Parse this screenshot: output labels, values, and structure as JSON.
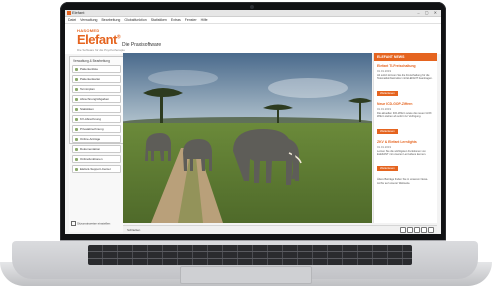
{
  "titlebar": {
    "title": "Elefant",
    "icon": "app-icon"
  },
  "menubar": {
    "items": [
      "Datei",
      "Verwaltung",
      "Bearbeitung",
      "Globalfunktion",
      "Statistiken",
      "Extras",
      "Fenster",
      "Hilfe"
    ]
  },
  "header": {
    "logo_top": "HASOMED",
    "logo_main": "Elefant",
    "logo_mark": "®",
    "logo_sub": "Die Software für die Psychotherapie",
    "page_title": "Die Praxisoftware"
  },
  "sidebar": {
    "heading": "Verwaltung & Bearbeitung",
    "items": [
      {
        "label": "Patientenliste"
      },
      {
        "label": "Patientenkartei"
      },
      {
        "label": "Terminplan"
      },
      {
        "label": "Abrechnung/Abgaben"
      },
      {
        "label": "Statistiken"
      },
      {
        "label": "KV-Abrechnung"
      },
      {
        "label": "Privatabrechnung"
      },
      {
        "label": "Online-Anträge"
      },
      {
        "label": "Dokumentation"
      },
      {
        "label": "Onlinefunktionen"
      },
      {
        "label": "Elefant-Support-Center"
      }
    ],
    "footer": "Sitzunsinweise einstellen"
  },
  "right_panel": {
    "header": "ELEFANT NEWS",
    "news": [
      {
        "title": "Elefant TI-Freischaltung",
        "date": "01.01.2019",
        "text": "Ab sofort können Sie die Freischaltung für die Telematikinfrastruktur mit ELEFANT beantragen.",
        "button": "Weiterlesen"
      },
      {
        "title": "Neue ICD-GOP-Ziffern",
        "date": "01.01.2019",
        "text": "Die aktuellen ICD-Ziffern sowie die neuen GOP-Ziffern stehen ab sofort zur Verfügung.",
        "button": "Weiterlesen"
      },
      {
        "title": "ZKV & Elefant Lernlights",
        "date": "01.01.2019",
        "text": "Lernen Sie die wichtigsten Funktionen von ELEFANT mit unseren Lernvideos kennen.",
        "button": "Weiterlesen"
      }
    ],
    "footer": "Ältere Beiträge finden Sie in unserem News-Archiv auf unserer Webseite."
  },
  "statusbar": {
    "text": "Schließen"
  },
  "colors": {
    "accent": "#e5641f",
    "photo_sky": "#a9c2d6",
    "savanna": "#6b8a3a"
  }
}
